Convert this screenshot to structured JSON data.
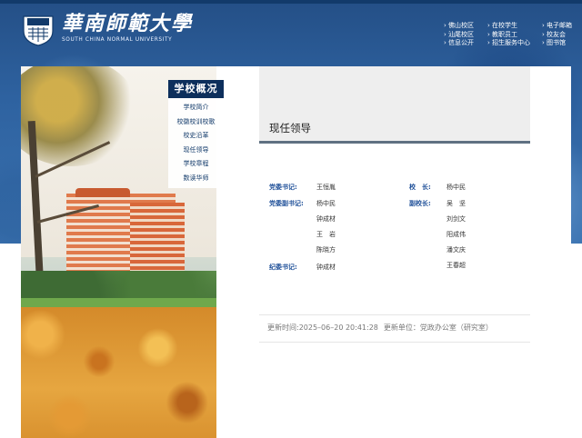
{
  "logo": {
    "cn": "華南師範大學",
    "en": "SOUTH CHINA NORMAL UNIVERSITY"
  },
  "topnav": [
    [
      "佛山校区",
      "汕尾校区",
      "信息公开"
    ],
    [
      "在校学生",
      "教职员工",
      "招生服务中心"
    ],
    [
      "电子邮箱",
      "校友会",
      "图书馆"
    ]
  ],
  "sidebar": {
    "title": "学校概况",
    "items": [
      "学校简介",
      "校徽校训校歌",
      "校史沿革",
      "现任领导",
      "学校章程",
      "数读华师"
    ]
  },
  "page": {
    "title": "现任领导"
  },
  "leaders": {
    "left": [
      {
        "label": "党委书记:",
        "names": [
          "王恒胤"
        ]
      },
      {
        "label": "党委副书记:",
        "names": [
          "杨中民",
          "钟成材",
          "王　岩",
          "陈晓方"
        ]
      },
      {
        "label": "纪委书记:",
        "names": [
          "钟成材"
        ]
      }
    ],
    "right": [
      {
        "label": "校　长:",
        "names": [
          "杨中民"
        ]
      },
      {
        "label": "副校长:",
        "names": [
          "吴　坚",
          "刘剑文",
          "阳成伟",
          "潘文庆",
          "王春超"
        ]
      }
    ]
  },
  "update": {
    "time": "更新时间:2025–06–20 20:41:28",
    "unit": "更新单位：党政办公室（研究室）"
  }
}
